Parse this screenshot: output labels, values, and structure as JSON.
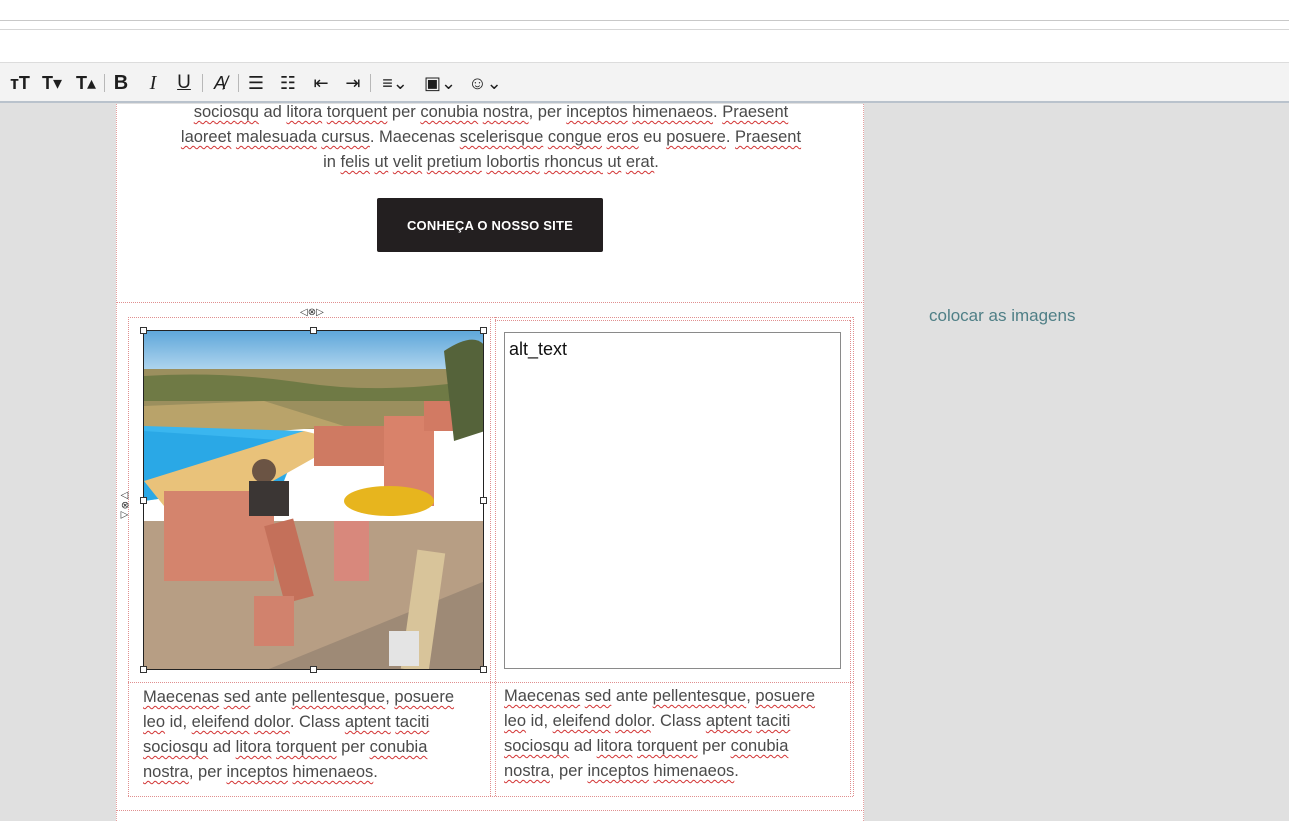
{
  "toolbar": {
    "buttons": [
      {
        "name": "font-size-icon",
        "glyph": "ᴛT"
      },
      {
        "name": "subscript-icon",
        "glyph": "T▾"
      },
      {
        "name": "superscript-icon",
        "glyph": "T▴"
      },
      {
        "name": "bold-icon",
        "glyph": "B"
      },
      {
        "name": "italic-icon",
        "glyph": "I"
      },
      {
        "name": "underline-icon",
        "glyph": "U"
      },
      {
        "name": "clear-format-icon",
        "glyph": "A̸"
      },
      {
        "name": "bullet-list-icon",
        "glyph": "☰"
      },
      {
        "name": "numbered-list-icon",
        "glyph": "☷"
      },
      {
        "name": "outdent-icon",
        "glyph": "⇤"
      },
      {
        "name": "indent-icon",
        "glyph": "⇥"
      },
      {
        "name": "align-icon",
        "glyph": "≡⌄"
      },
      {
        "name": "image-icon",
        "glyph": "▣⌄"
      },
      {
        "name": "emoji-icon",
        "glyph": "☺⌄"
      }
    ]
  },
  "top_paragraph": {
    "line1": {
      "w1": "sociosqu",
      "t1": " ad ",
      "w2": "litora",
      "t2": " ",
      "w3": "torquent",
      "t3": " per ",
      "w4": "conubia",
      "t4": " ",
      "w5": "nostra",
      "t5": ", per ",
      "w6": "inceptos",
      "t6": " ",
      "w7": "himenaeos",
      "t7": ". ",
      "w8": "Praesent"
    },
    "line2": {
      "w1": "laoreet",
      "t1": " ",
      "w2": "malesuada",
      "t2": " ",
      "w3": "cursus",
      "t3": ". Maecenas ",
      "w4": "scelerisque",
      "t4": " ",
      "w5": "congue",
      "t5": " ",
      "w6": "eros",
      "t6": " eu ",
      "w7": "posuere",
      "t7": ". ",
      "w8": "Praesent"
    },
    "line3": {
      "t0": "in ",
      "w1": "felis",
      "t1": " ",
      "w2": "ut",
      "t2": " ",
      "w3": "velit",
      "t3": " ",
      "w4": "pretium",
      "t4": " ",
      "w5": "lobortis",
      "t5": " ",
      "w6": "rhoncus",
      "t6": " ",
      "w7": "ut",
      "t7": " ",
      "w8": "erat",
      "t8": "."
    }
  },
  "cta_button": {
    "label": "CONHEÇA O NOSSO SITE"
  },
  "alt_box": {
    "text": "alt_text"
  },
  "columns": [
    {
      "l1a": "Maecenas",
      "l1b": " ",
      "l1c": "sed",
      "l1d": " ante ",
      "l1e": "pellentesque",
      "l1f": ", ",
      "l1g": "posuere",
      "l2a": "leo",
      "l2b": " id, ",
      "l2c": "eleifend",
      "l2d": " ",
      "l2e": "dolor",
      "l2f": ". Class ",
      "l2g": "aptent",
      "l2h": " ",
      "l2i": "taciti",
      "l3a": "sociosqu",
      "l3b": " ad ",
      "l3c": "litora",
      "l3d": " ",
      "l3e": "torquent",
      "l3f": " per ",
      "l3g": "conubia",
      "l4a": "nostra",
      "l4b": ", per ",
      "l4c": "inceptos",
      "l4d": " ",
      "l4e": "himenaeos",
      "l4f": "."
    },
    {
      "l1a": "Maecenas",
      "l1b": " ",
      "l1c": "sed",
      "l1d": " ante ",
      "l1e": "pellentesque",
      "l1f": ", ",
      "l1g": "posuere",
      "l2a": "leo",
      "l2b": " id, ",
      "l2c": "eleifend",
      "l2d": " ",
      "l2e": "dolor",
      "l2f": ". Class ",
      "l2g": "aptent",
      "l2h": " ",
      "l2i": "taciti",
      "l3a": "sociosqu",
      "l3b": " ad ",
      "l3c": "litora",
      "l3d": " ",
      "l3e": "torquent",
      "l3f": " per ",
      "l3g": "conubia",
      "l4a": "nostra",
      "l4b": ", per ",
      "l4c": "inceptos",
      "l4d": " ",
      "l4e": "himenaeos",
      "l4f": "."
    }
  ],
  "side_note": {
    "text": "colocar as imagens"
  },
  "colors": {
    "button_bg": "#231f20",
    "note": "#4f7f86",
    "spell_underline": "#d23333"
  }
}
